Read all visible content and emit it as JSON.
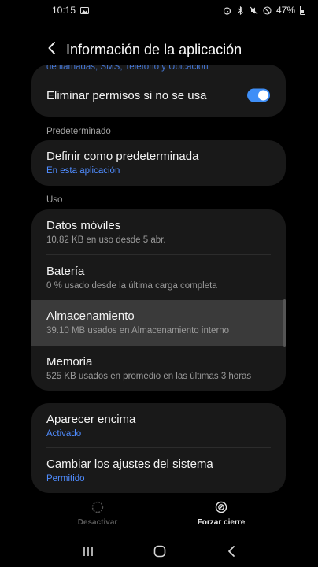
{
  "status_bar": {
    "time": "10:15",
    "battery": "47%"
  },
  "header": {
    "title": "Información de la aplicación"
  },
  "top_card": {
    "clipped_text": "de llamadas, SMS, Teléfono y Ubicación",
    "remove_permissions_label": "Eliminar permisos si no se usa",
    "remove_permissions_enabled": true
  },
  "sections": {
    "default_label": "Predeterminado",
    "usage_label": "Uso"
  },
  "default_card": {
    "title": "Definir como predeterminada",
    "subtitle": "En esta aplicación"
  },
  "usage_card": {
    "items": [
      {
        "title": "Datos móviles",
        "subtitle": "10.82 KB en uso desde 5 abr."
      },
      {
        "title": "Batería",
        "subtitle": "0 % usado desde la última carga completa"
      },
      {
        "title": "Almacenamiento",
        "subtitle": "39.10 MB usados en Almacenamiento interno"
      },
      {
        "title": "Memoria",
        "subtitle": "525 KB usados en promedio en las últimas 3 horas"
      }
    ]
  },
  "perm_card": {
    "items": [
      {
        "title": "Aparecer encima",
        "subtitle": "Activado"
      },
      {
        "title": "Cambiar los ajustes del sistema",
        "subtitle": "Permitido"
      }
    ]
  },
  "bottom_actions": {
    "disable_label": "Desactivar",
    "force_stop_label": "Forzar cierre"
  },
  "colors": {
    "accent": "#3e8ef7",
    "link": "#4f8cff",
    "card": "#191919",
    "highlight": "#3a3a3a"
  }
}
